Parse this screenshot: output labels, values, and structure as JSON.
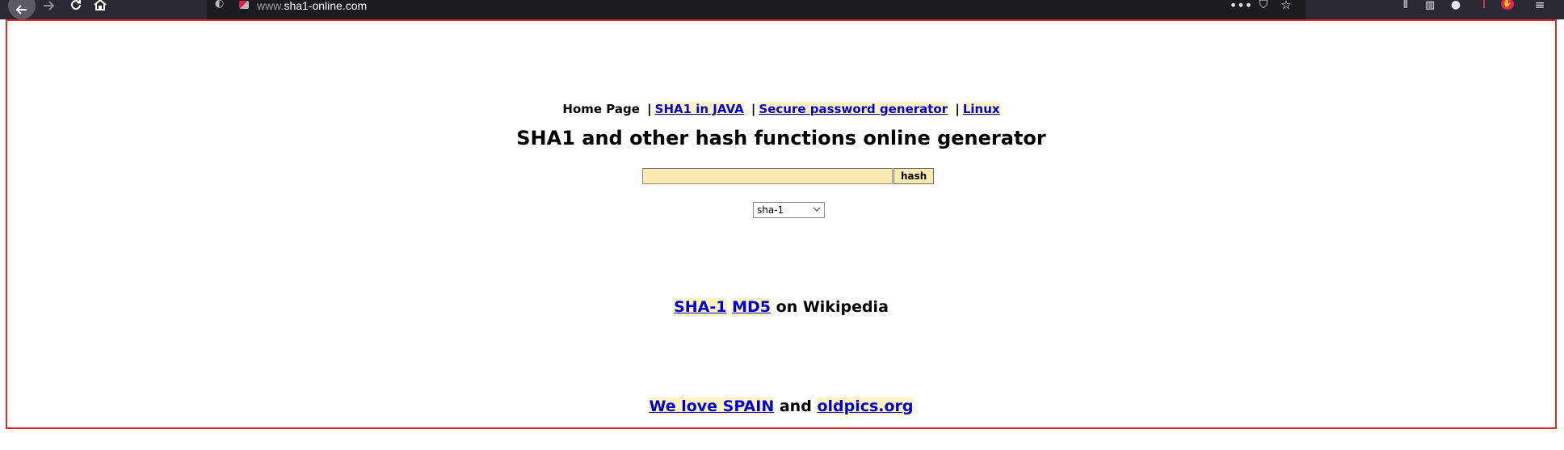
{
  "browser": {
    "url_prefix": "www.",
    "url_host": "sha1-online.com",
    "icons": [
      "back-arrow-icon",
      "forward-arrow-icon",
      "reload-icon",
      "home-icon",
      "tracking-shield-icon",
      "page-actions-icon",
      "pocket-icon",
      "bookmark-star-icon",
      "library-icon",
      "sidebar-icon",
      "account-icon",
      "extension-icon",
      "menu-icon"
    ]
  },
  "nav": {
    "home": "Home Page",
    "sep": "|",
    "sha1_java": "SHA1 in JAVA",
    "password": "Secure password generator",
    "linux": "Linux"
  },
  "heading": "SHA1 and other hash functions online generator",
  "form": {
    "input_value": "",
    "button": "hash",
    "algorithm_selected": "sha-1"
  },
  "wiki": {
    "sha1": "SHA-1",
    "md5": "MD5",
    "suffix": "on Wikipedia"
  },
  "footer": {
    "spain": "We love SPAIN",
    "and": "and",
    "oldpics": "oldpics.org"
  },
  "colors": {
    "link": "#0000cc",
    "link_bg": "#fdf2c2",
    "input_bg": "#fdeab0",
    "frame_border": "#e22828",
    "toolbar_bg": "#2b2a33"
  }
}
